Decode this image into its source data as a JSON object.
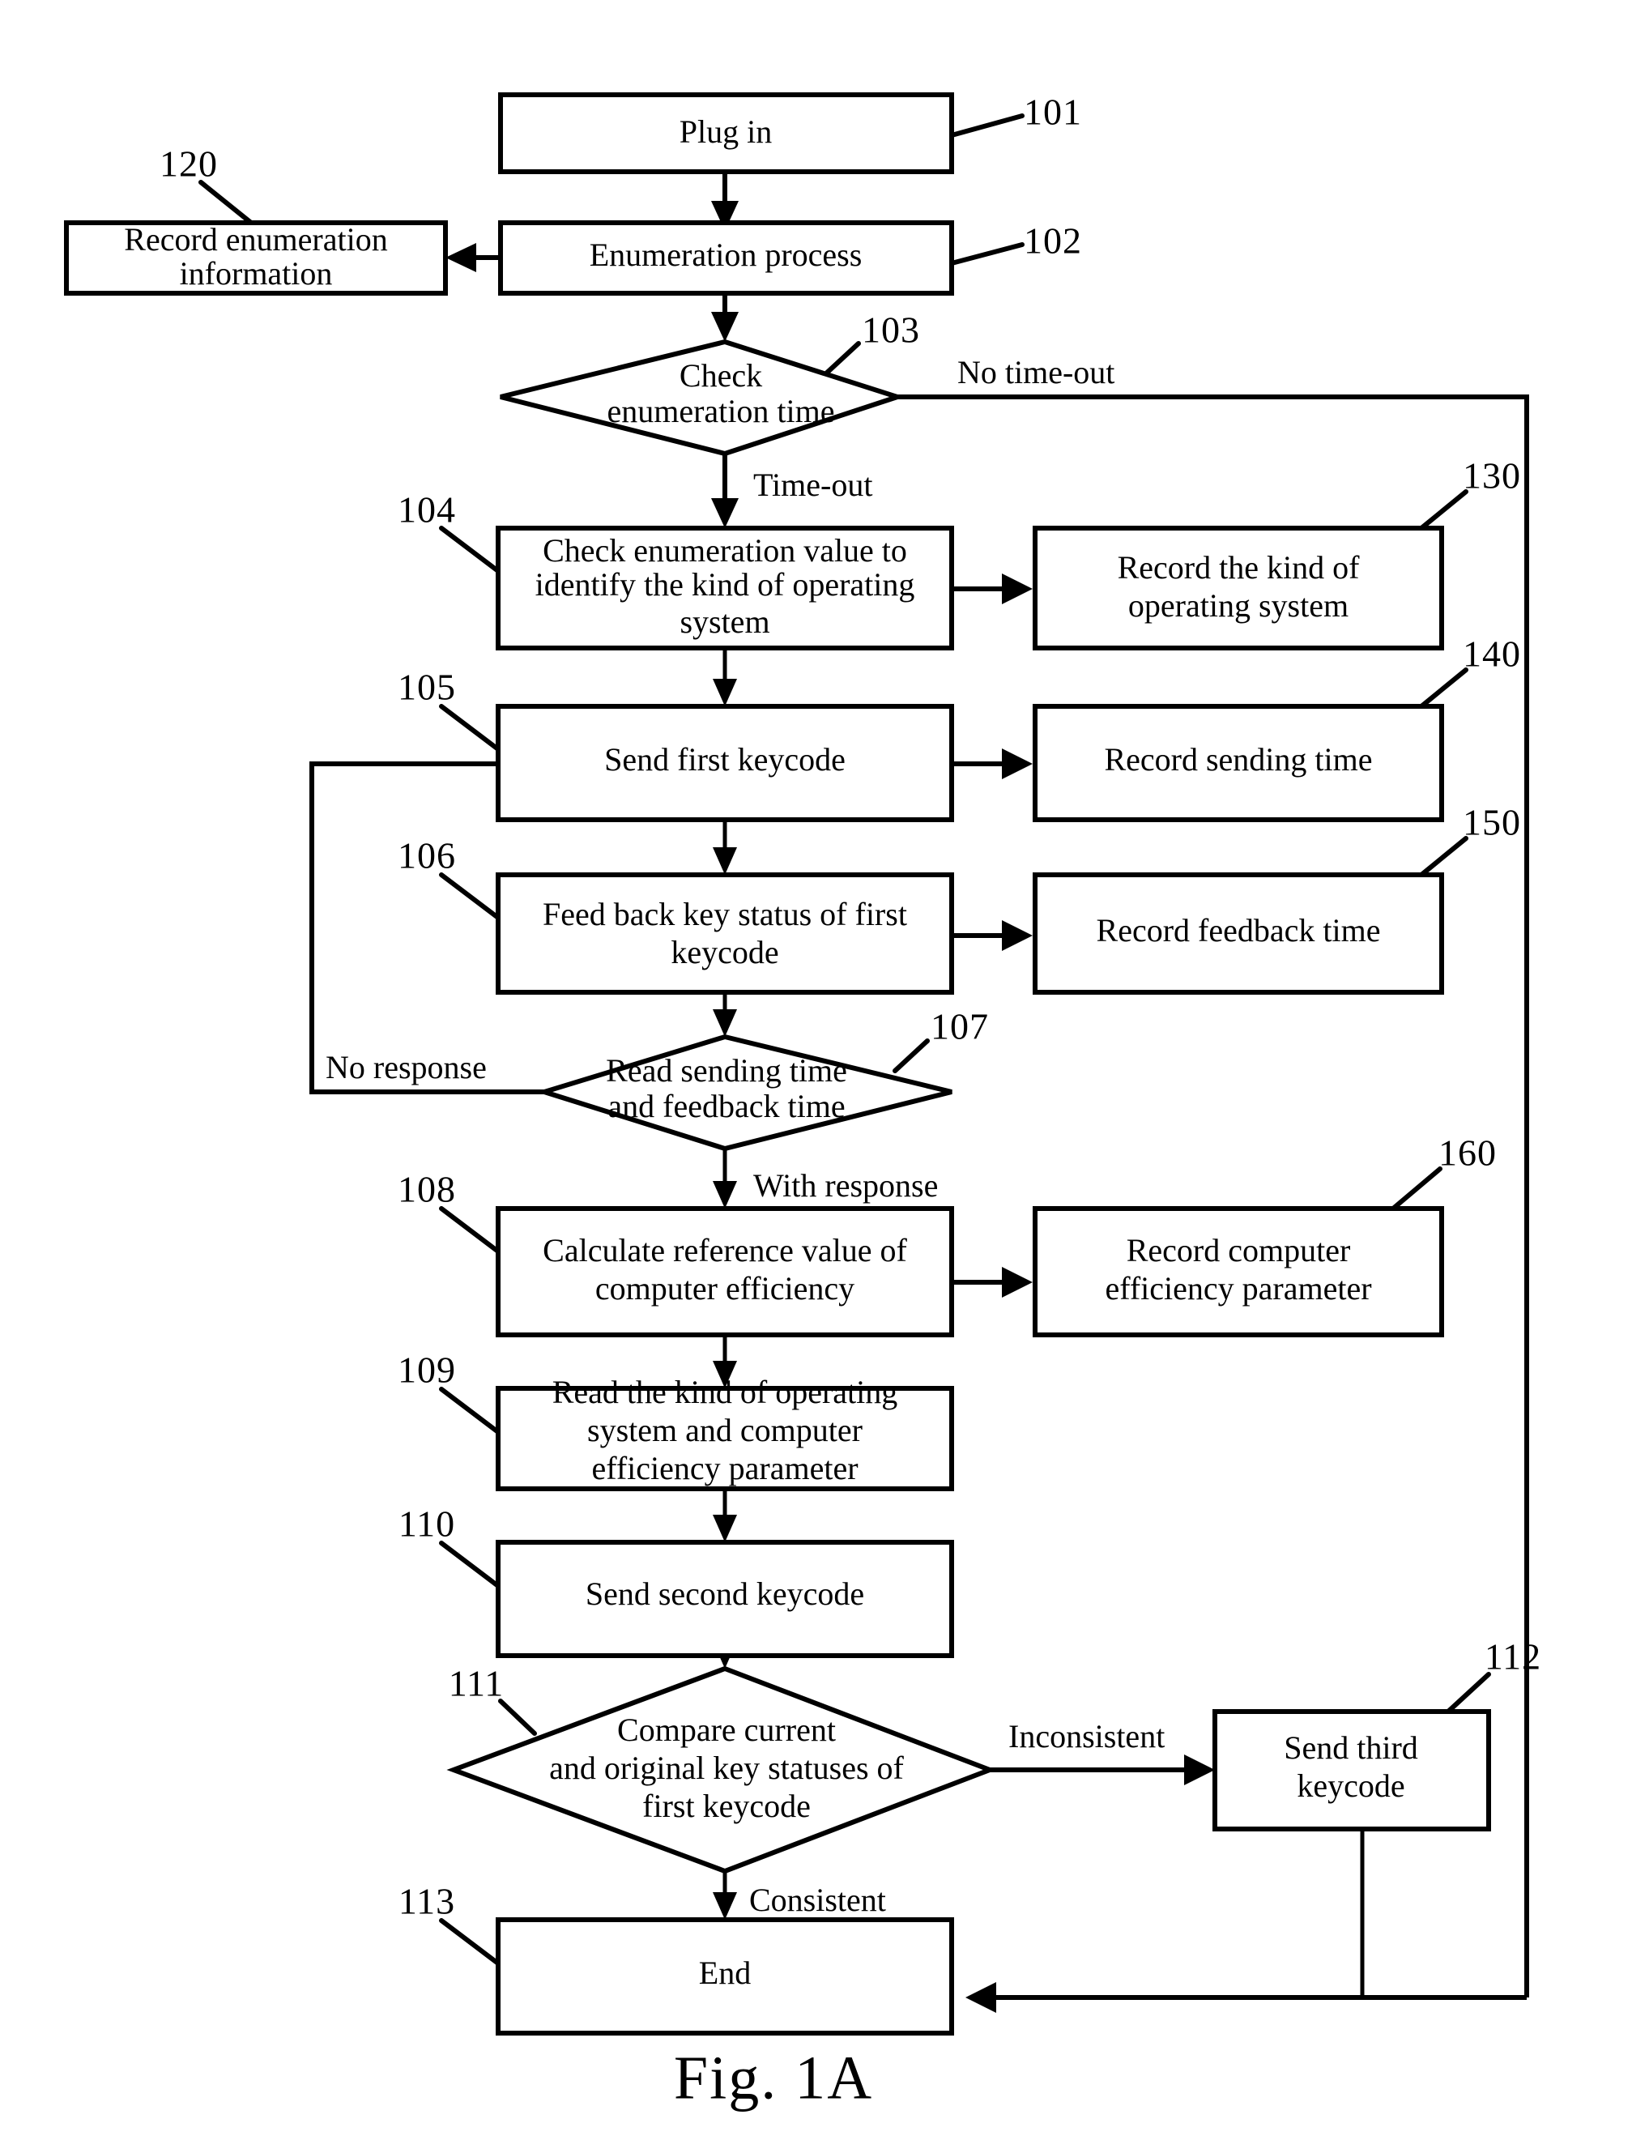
{
  "figure": {
    "caption": "Fig. 1A",
    "type": "patent-flowchart"
  },
  "nodes": {
    "n101": {
      "ref": "101",
      "label": "Plug in",
      "shape": "process"
    },
    "n102": {
      "ref": "102",
      "label": "Enumeration process",
      "shape": "process"
    },
    "n120": {
      "ref": "120",
      "label_line1": "Record enumeration",
      "label_line2": "information",
      "shape": "process"
    },
    "n103": {
      "ref": "103",
      "label_line1": "Check",
      "label_line2": "enumeration time",
      "shape": "decision"
    },
    "n104": {
      "ref": "104",
      "label_line1": "Check enumeration value to",
      "label_line2": "identify the kind of operating",
      "label_line3": "system",
      "shape": "process"
    },
    "n130": {
      "ref": "130",
      "label_line1": "Record the kind of",
      "label_line2": "operating system",
      "shape": "process"
    },
    "n105": {
      "ref": "105",
      "label": "Send first keycode",
      "shape": "process"
    },
    "n140": {
      "ref": "140",
      "label": "Record sending time",
      "shape": "process"
    },
    "n106": {
      "ref": "106",
      "label_line1": "Feed back key status of first",
      "label_line2": "keycode",
      "shape": "process"
    },
    "n150": {
      "ref": "150",
      "label": "Record feedback time",
      "shape": "process"
    },
    "n107": {
      "ref": "107",
      "label_line1": "Read sending time",
      "label_line2": "and feedback time",
      "shape": "decision"
    },
    "n108": {
      "ref": "108",
      "label_line1": "Calculate reference value of",
      "label_line2": "computer efficiency",
      "shape": "process"
    },
    "n160": {
      "ref": "160",
      "label_line1": "Record computer",
      "label_line2": "efficiency parameter",
      "shape": "process"
    },
    "n109": {
      "ref": "109",
      "label_line1": "Read the kind of operating",
      "label_line2": "system and computer",
      "label_line3": "efficiency parameter",
      "shape": "process"
    },
    "n110": {
      "ref": "110",
      "label": "Send second keycode",
      "shape": "process"
    },
    "n111": {
      "ref": "111",
      "label_line1": "Compare current",
      "label_line2": "and original key statuses of",
      "label_line3": "first keycode",
      "shape": "decision"
    },
    "n112": {
      "ref": "112",
      "label_line1": "Send third",
      "label_line2": "keycode",
      "shape": "process"
    },
    "n113": {
      "ref": "113",
      "label": "End",
      "shape": "process"
    }
  },
  "edge_labels": {
    "no_timeout": "No time-out",
    "timeout": "Time-out",
    "no_response": "No response",
    "with_response": "With response",
    "inconsistent": "Inconsistent",
    "consistent": "Consistent"
  },
  "colors": {
    "stroke": "#000000",
    "fill": "#ffffff",
    "background": "#ffffff"
  }
}
